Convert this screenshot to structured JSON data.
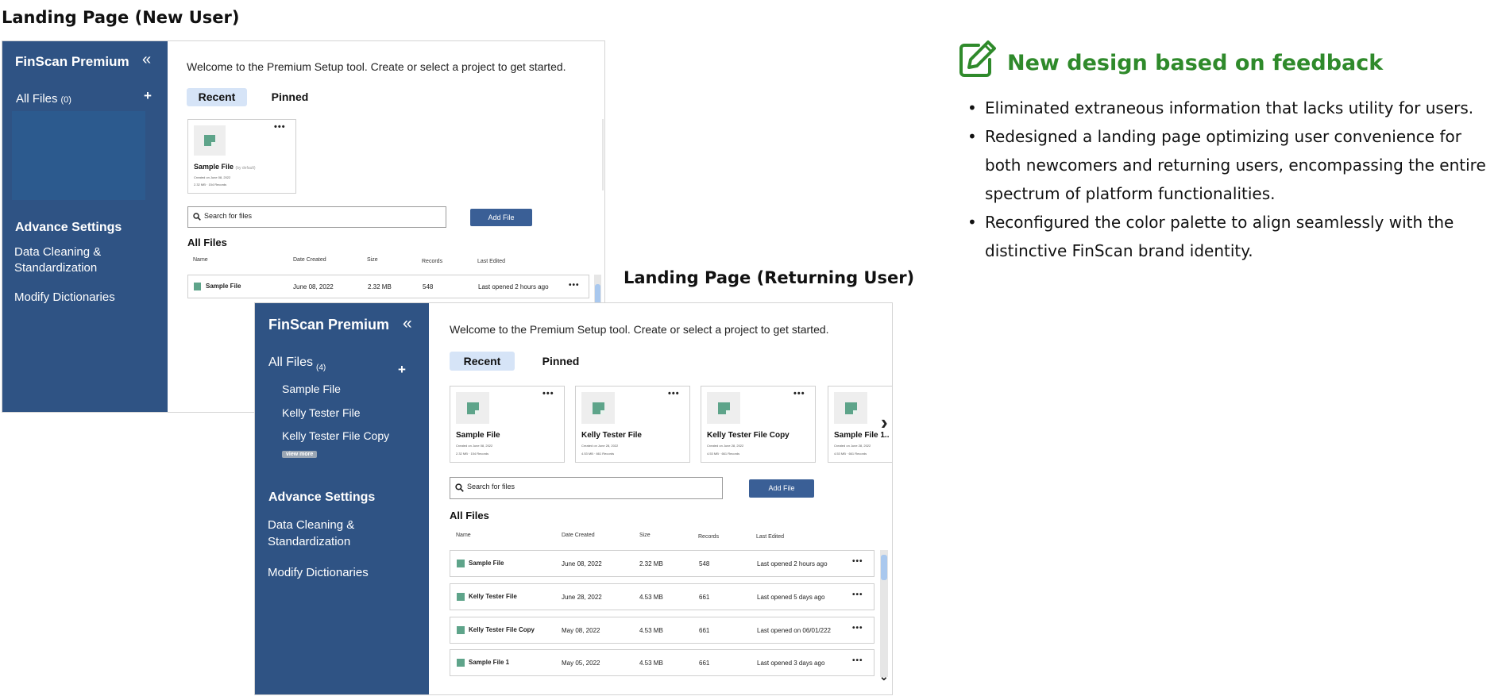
{
  "captions": {
    "new_user": "Landing Page (New User)",
    "returning_user": "Landing Page (Returning  User)"
  },
  "feedback": {
    "title": "New design based on feedback",
    "icon": "edit-pencil-icon",
    "accent_color": "#2f8a2b",
    "bullets": [
      "Eliminated extraneous information that lacks utility for users.",
      "Redesigned a landing page optimizing user convenience for both newcomers and returning users, encompassing the entire spectrum of platform functionalities.",
      "Reconfigured the color palette to align seamlessly with the distinctive FinScan brand identity."
    ]
  },
  "colors": {
    "sidebar": "#2f5384",
    "button": "#3a5f96",
    "active_tab": "#d6e4f7",
    "file_icon": "#5ea48a"
  },
  "new_user": {
    "sidebar": {
      "app_title": "FinScan Premium",
      "collapse_icon": "«",
      "all_files_label": "All Files",
      "all_files_count": "(0)",
      "add_icon": "+",
      "advance_settings": "Advance Settings",
      "data_cleaning_line1": "Data Cleaning &",
      "data_cleaning_line2": "Standardization",
      "modify_dictionaries": "Modify Dictionaries"
    },
    "main": {
      "welcome": "Welcome to the Premium Setup tool. Create or select a project to get started.",
      "tabs": [
        "Recent",
        "Pinned"
      ],
      "recent_cards": [
        {
          "name": "Sample File",
          "owner": "(by default)",
          "created": "Created on June 08, 2022",
          "stats": "2.32 MB · 154 Records",
          "menu": "•••"
        }
      ],
      "search_placeholder": "Search for files",
      "add_file": "Add File",
      "all_files_title": "All Files",
      "columns": [
        "Name",
        "Date Created",
        "Size",
        "Records",
        "Last Edited"
      ],
      "rows": [
        {
          "name": "Sample File",
          "date": "June 08, 2022",
          "size": "2.32 MB",
          "records": "548",
          "last": "Last opened 2 hours ago",
          "menu": "•••"
        }
      ]
    }
  },
  "returning_user": {
    "sidebar": {
      "app_title": "FinScan Premium",
      "collapse_icon": "«",
      "all_files_label": "All Files",
      "all_files_count": "(4)",
      "add_icon": "+",
      "files": [
        "Sample File",
        "Kelly Tester File",
        "Kelly Tester File Copy"
      ],
      "view_more": "view more",
      "advance_settings": "Advance Settings",
      "data_cleaning_line1": "Data Cleaning &",
      "data_cleaning_line2": "Standardization",
      "modify_dictionaries": "Modify Dictionaries"
    },
    "main": {
      "welcome": "Welcome to the Premium Setup tool. Create or select a project to get started.",
      "tabs": [
        "Recent",
        "Pinned"
      ],
      "recent_cards": [
        {
          "name": "Sample File",
          "created": "Created on June 08, 2022",
          "stats": "2.32 MB · 154 Records",
          "menu": "•••"
        },
        {
          "name": "Kelly Tester File",
          "created": "Created on June 28, 2022",
          "stats": "4.53 MB · 661 Records",
          "menu": "•••"
        },
        {
          "name": "Kelly Tester File Copy",
          "created": "Created on June 28, 2022",
          "stats": "4.53 MB · 661 Records",
          "menu": "•••"
        },
        {
          "name": "Sample File 1..",
          "created": "Created on June 28, 2022",
          "stats": "4.53 MB · 661 Records",
          "menu": "•••"
        }
      ],
      "next_icon": "›",
      "search_placeholder": "Search for files",
      "add_file": "Add File",
      "all_files_title": "All Files",
      "columns": [
        "Name",
        "Date Created",
        "Size",
        "Records",
        "Last Edited"
      ],
      "rows": [
        {
          "name": "Sample File",
          "date": "June 08, 2022",
          "size": "2.32 MB",
          "records": "548",
          "last": "Last opened 2 hours ago",
          "menu": "•••"
        },
        {
          "name": "Kelly Tester File",
          "date": "June 28, 2022",
          "size": "4.53 MB",
          "records": "661",
          "last": "Last opened 5 days ago",
          "menu": "•••"
        },
        {
          "name": "Kelly Tester File Copy",
          "date": "May 08, 2022",
          "size": "4.53 MB",
          "records": "661",
          "last": "Last opened on 06/01/222",
          "menu": "•••"
        },
        {
          "name": "Sample File 1",
          "date": "May 05, 2022",
          "size": "4.53 MB",
          "records": "661",
          "last": "Last opened 3 days ago",
          "menu": "•••"
        }
      ],
      "scroll_down_icon": "⌄"
    }
  }
}
